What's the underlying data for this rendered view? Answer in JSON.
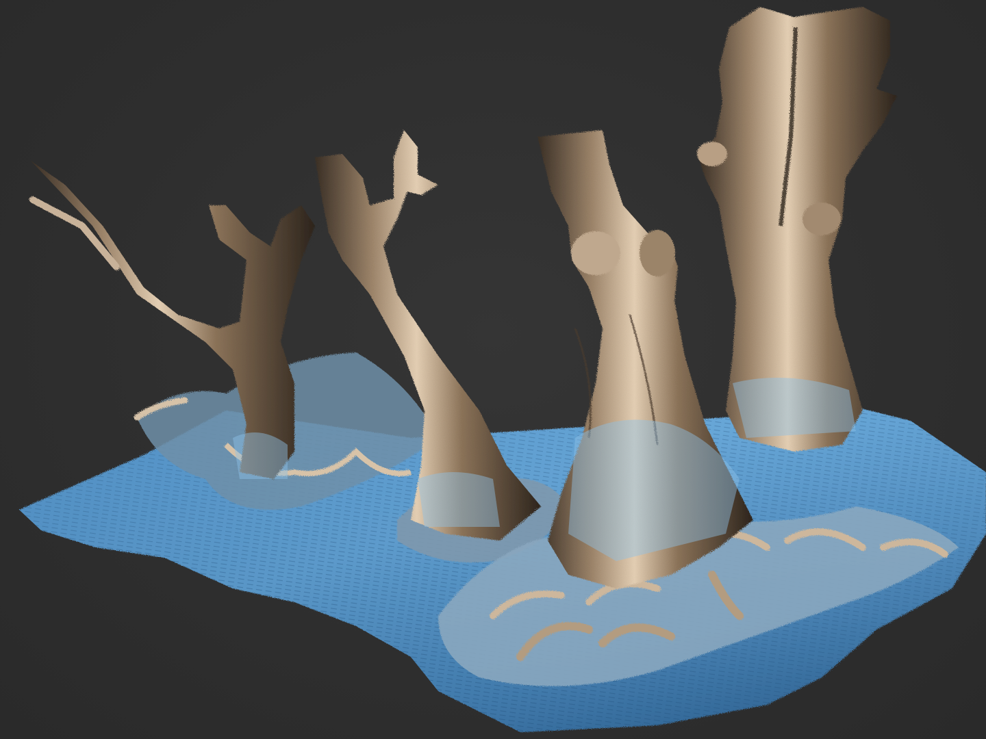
{
  "viewport": {
    "background_color": "#2f2f2f",
    "subject": "tree-stumps-3d-scan",
    "material_colors": {
      "bark_highlight": "#d8c3a8",
      "bark_mid": "#8a7258",
      "bark_shadow": "#2d241c",
      "ground_blue": "#4f8fc4",
      "ground_blue_light": "#8cc3ea",
      "ground_blue_dark": "#1f4a72"
    }
  }
}
